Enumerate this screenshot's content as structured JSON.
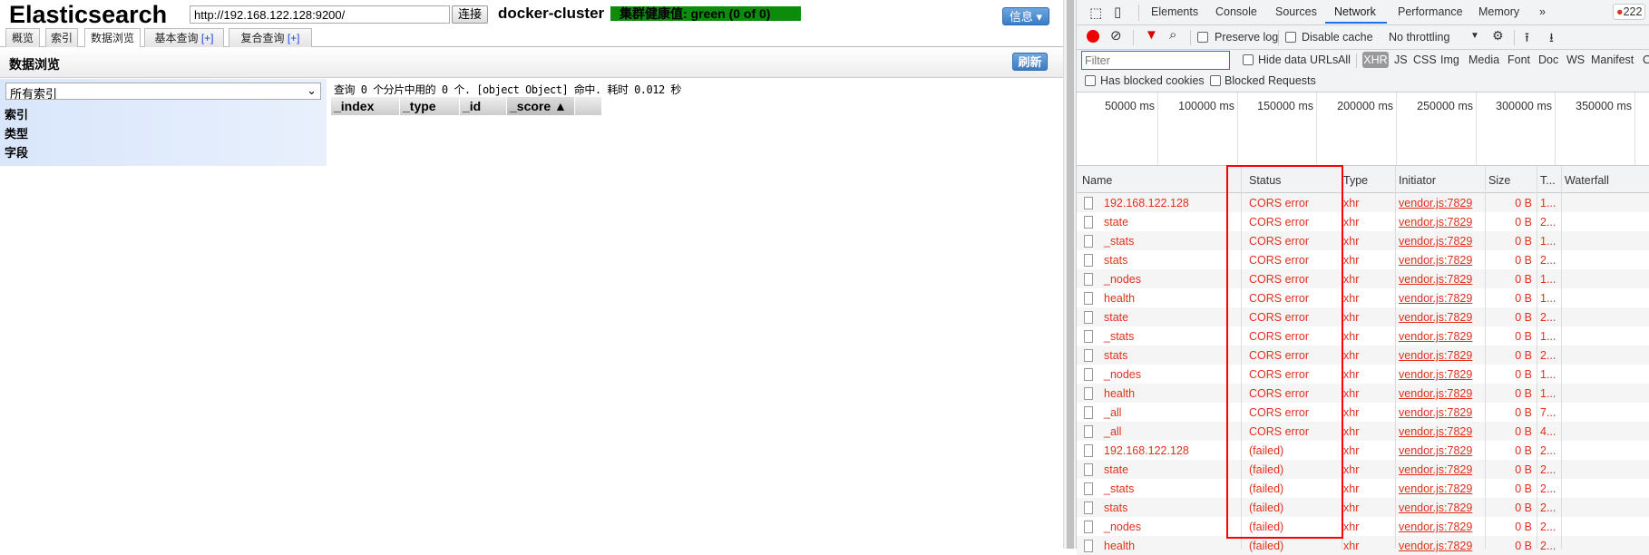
{
  "app": {
    "title": "Elasticsearch",
    "url_value": "http://192.168.122.128:9200/",
    "connect_label": "连接",
    "cluster_name": "docker-cluster",
    "health_label": "集群健康值: green (0 of 0)",
    "health_color": "#0b8d0b",
    "info_label": "信息 ▾",
    "tabs": [
      {
        "label": "概览"
      },
      {
        "label": "索引"
      },
      {
        "label": "数据浏览",
        "active": true
      },
      {
        "label": "基本查询",
        "plus": "[+]"
      },
      {
        "label": "复合查询",
        "plus": "[+]"
      }
    ],
    "section_title": "数据浏览",
    "refresh_label": "刷新",
    "index_select": "所有索引",
    "filters": [
      "索引",
      "类型",
      "字段"
    ],
    "query_summary": "查询 0 个分片中用的 0 个. [object Object] 命中. 耗时 0.012 秒",
    "table_headers": [
      "_index",
      "_type",
      "_id",
      "_score ▲"
    ]
  },
  "devtools": {
    "tabs": [
      "Elements",
      "Console",
      "Sources",
      "Network",
      "Performance",
      "Memory",
      "»"
    ],
    "active_tab": "Network",
    "error_count": "222",
    "preserve_log": "Preserve log",
    "disable_cache": "Disable cache",
    "throttling": "No throttling",
    "filter_placeholder": "Filter",
    "hide_data_urls": "Hide data URLs",
    "type_filters": [
      "All",
      "XHR",
      "JS",
      "CSS",
      "Img",
      "Media",
      "Font",
      "Doc",
      "WS",
      "Manifest",
      "O"
    ],
    "active_type": "XHR",
    "has_blocked_cookies": "Has blocked cookies",
    "blocked_requests": "Blocked Requests",
    "timeline_ticks": [
      "50000 ms",
      "100000 ms",
      "150000 ms",
      "200000 ms",
      "250000 ms",
      "300000 ms",
      "350000 ms"
    ],
    "columns": [
      "Name",
      "Status",
      "Type",
      "Initiator",
      "Size",
      "T...",
      "Waterfall"
    ],
    "error_color": "#e0301e",
    "rows": [
      {
        "name": "192.168.122.128",
        "status": "CORS error",
        "type": "xhr",
        "initiator": "vendor.js:7829",
        "size": "0 B",
        "time": "1..."
      },
      {
        "name": "state",
        "status": "CORS error",
        "type": "xhr",
        "initiator": "vendor.js:7829",
        "size": "0 B",
        "time": "2..."
      },
      {
        "name": "_stats",
        "status": "CORS error",
        "type": "xhr",
        "initiator": "vendor.js:7829",
        "size": "0 B",
        "time": "1..."
      },
      {
        "name": "stats",
        "status": "CORS error",
        "type": "xhr",
        "initiator": "vendor.js:7829",
        "size": "0 B",
        "time": "2..."
      },
      {
        "name": "_nodes",
        "status": "CORS error",
        "type": "xhr",
        "initiator": "vendor.js:7829",
        "size": "0 B",
        "time": "1..."
      },
      {
        "name": "health",
        "status": "CORS error",
        "type": "xhr",
        "initiator": "vendor.js:7829",
        "size": "0 B",
        "time": "1..."
      },
      {
        "name": "state",
        "status": "CORS error",
        "type": "xhr",
        "initiator": "vendor.js:7829",
        "size": "0 B",
        "time": "2..."
      },
      {
        "name": "_stats",
        "status": "CORS error",
        "type": "xhr",
        "initiator": "vendor.js:7829",
        "size": "0 B",
        "time": "1..."
      },
      {
        "name": "stats",
        "status": "CORS error",
        "type": "xhr",
        "initiator": "vendor.js:7829",
        "size": "0 B",
        "time": "2..."
      },
      {
        "name": "_nodes",
        "status": "CORS error",
        "type": "xhr",
        "initiator": "vendor.js:7829",
        "size": "0 B",
        "time": "1..."
      },
      {
        "name": "health",
        "status": "CORS error",
        "type": "xhr",
        "initiator": "vendor.js:7829",
        "size": "0 B",
        "time": "1..."
      },
      {
        "name": "_all",
        "status": "CORS error",
        "type": "xhr",
        "initiator": "vendor.js:7829",
        "size": "0 B",
        "time": "7..."
      },
      {
        "name": "_all",
        "status": "CORS error",
        "type": "xhr",
        "initiator": "vendor.js:7829",
        "size": "0 B",
        "time": "4..."
      },
      {
        "name": "192.168.122.128",
        "status": "(failed)",
        "type": "xhr",
        "initiator": "vendor.js:7829",
        "size": "0 B",
        "time": "2..."
      },
      {
        "name": "state",
        "status": "(failed)",
        "type": "xhr",
        "initiator": "vendor.js:7829",
        "size": "0 B",
        "time": "2..."
      },
      {
        "name": "_stats",
        "status": "(failed)",
        "type": "xhr",
        "initiator": "vendor.js:7829",
        "size": "0 B",
        "time": "2..."
      },
      {
        "name": "stats",
        "status": "(failed)",
        "type": "xhr",
        "initiator": "vendor.js:7829",
        "size": "0 B",
        "time": "2..."
      },
      {
        "name": "_nodes",
        "status": "(failed)",
        "type": "xhr",
        "initiator": "vendor.js:7829",
        "size": "0 B",
        "time": "2..."
      },
      {
        "name": "health",
        "status": "(failed)",
        "type": "xhr",
        "initiator": "vendor.js:7829",
        "size": "0 B",
        "time": "2..."
      }
    ]
  }
}
